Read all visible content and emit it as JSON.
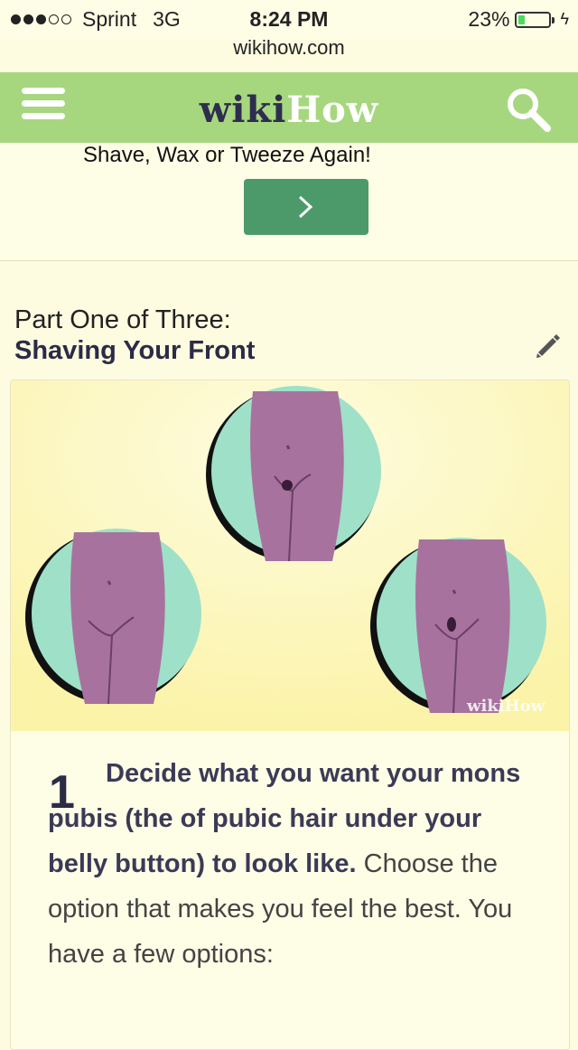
{
  "status_bar": {
    "carrier": "Sprint",
    "network": "3G",
    "time": "8:24 PM",
    "battery_percent": "23%",
    "battery_level": 0.23,
    "url": "wikihow.com"
  },
  "header": {
    "logo_wiki": "wiki",
    "logo_how": "How",
    "menu_icon": "hamburger-menu-icon",
    "search_icon": "search-icon"
  },
  "ad": {
    "text": "Shave, Wax or Tweeze Again!",
    "button_icon": "chevron-right-icon"
  },
  "section": {
    "part_label": "Part One of Three:",
    "part_title": "Shaving Your Front",
    "edit_icon": "pencil-icon"
  },
  "step": {
    "image_watermark": "wikiHow",
    "number": "1",
    "bold_text": "Decide what you want your mons pubis (the of pubic hair under your belly button) to look like.",
    "body_text": " Choose the option that makes you feel the best. You have a few options:"
  },
  "colors": {
    "header_green": "#a6d77e",
    "button_green": "#4c9a6a",
    "logo_dark": "#2e2d4e",
    "circle_teal": "#9fe0c8",
    "figure_purple": "#a7739e"
  }
}
